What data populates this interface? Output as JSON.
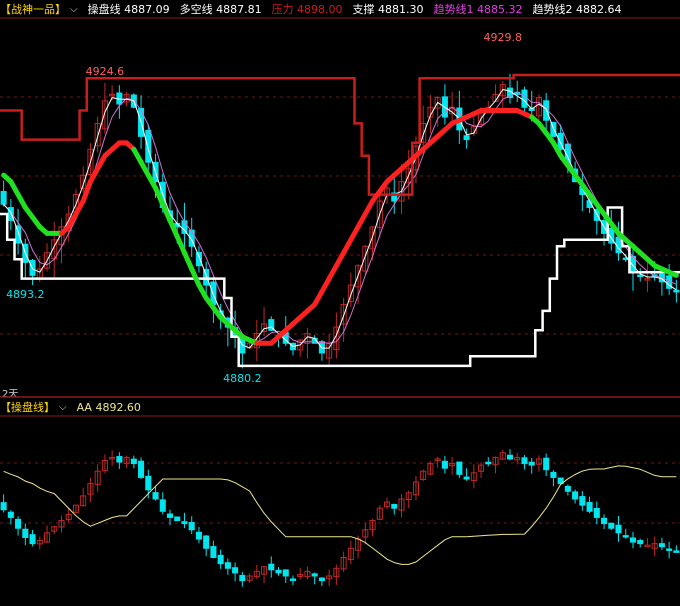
{
  "top_legend": {
    "indicator_name": "【战神一品】",
    "items": [
      {
        "label": "操盘线",
        "value": "4887.09",
        "color": "#ffffff"
      },
      {
        "label": "多空线",
        "value": "4887.81",
        "color": "#ffffff"
      },
      {
        "label": "压力",
        "value": "4898.00",
        "color": "#c81e1e"
      },
      {
        "label": "支撑",
        "value": "4881.30",
        "color": "#ffffff"
      },
      {
        "label": "趋势线1",
        "value": "4885.32",
        "color": "#e040e0"
      },
      {
        "label": "趋势线2",
        "value": "4882.64",
        "color": "#ffffff"
      }
    ]
  },
  "bottom_legend": {
    "indicator_name": "【操盘线】",
    "items": [
      {
        "label": "AA",
        "value": "4892.60",
        "color": "#f0e68c"
      }
    ]
  },
  "period_label": "2天",
  "colors": {
    "up": "#c02828",
    "down": "#00e5ee",
    "resistance": "#c81e1e",
    "support": "#ffffff",
    "trend_up": "#ff2020",
    "trend_down": "#20e020",
    "ma_fast": "#ffffff",
    "ma_slow": "#d070d0",
    "aa_line": "#f0e68c",
    "grid": "#6a1a1a",
    "border": "#8b1a1a"
  },
  "chart_data": [
    {
      "type": "candlestick",
      "y_range": [
        4876,
        4934
      ],
      "annotations": [
        {
          "text": "4924.6",
          "value": 4924.6,
          "index": 14,
          "color": "#ff6060"
        },
        {
          "text": "4929.8",
          "value": 4929.8,
          "index": 69,
          "color": "#ff6060"
        },
        {
          "text": "4893.2",
          "value": 4893.2,
          "index": 3,
          "color": "#00e5ee"
        },
        {
          "text": "4880.2",
          "value": 4880.2,
          "index": 33,
          "color": "#00e5ee"
        }
      ],
      "closes": [
        4905.5,
        4903,
        4899.5,
        4896.5,
        4894.5,
        4895.5,
        4898,
        4900,
        4902,
        4904,
        4907,
        4910,
        4914,
        4918,
        4921.5,
        4922.5,
        4921,
        4922.5,
        4920.5,
        4916,
        4912,
        4909,
        4905,
        4903,
        4902,
        4901,
        4899,
        4896,
        4893,
        4890,
        4888,
        4886.5,
        4885,
        4882.5,
        4884,
        4885.5,
        4887,
        4886,
        4885,
        4884,
        4883,
        4884.5,
        4885.5,
        4884,
        4882.5,
        4884,
        4886.5,
        4890,
        4893,
        4896,
        4899,
        4902,
        4906,
        4908,
        4906,
        4909,
        4911,
        4914.5,
        4918,
        4920.5,
        4922,
        4919,
        4920.5,
        4917,
        4915.5,
        4917.5,
        4920,
        4920.5,
        4922.5,
        4924,
        4922,
        4922.5,
        4920.5,
        4920,
        4922,
        4918.5,
        4916,
        4914,
        4911.5,
        4909,
        4907,
        4905,
        4903,
        4901,
        4899.5,
        4898,
        4897,
        4895,
        4894.5,
        4894,
        4894.5,
        4893.5,
        4892.5,
        4892
      ],
      "resistance": [
        4920,
        4920,
        4920,
        4915.5,
        4915.5,
        4915.5,
        4915.5,
        4915.5,
        4915.5,
        4915.5,
        4915.5,
        4920,
        4925,
        4925,
        4925,
        4925,
        4925,
        4925,
        4925,
        4925,
        4925,
        4925,
        4925,
        4925,
        4925,
        4925,
        4925,
        4925,
        4925,
        4925,
        4925,
        4925,
        4925,
        4925,
        4925,
        4925,
        4925,
        4925,
        4925,
        4925,
        4925,
        4925,
        4925,
        4925,
        4925,
        4925,
        4925,
        4925,
        4925,
        4918,
        4913,
        4907,
        4907,
        4907,
        4907,
        4907,
        4907,
        4915,
        4925,
        4925,
        4925,
        4925,
        4925,
        4925,
        4925,
        4925,
        4925,
        4925,
        4925,
        4925,
        4925,
        4925.5,
        4925.5,
        4925.5,
        4925.5,
        4925.5,
        4925.5,
        4925.5,
        4925.5,
        4925.5,
        4925.5,
        4925.5,
        4925.5,
        4925.5,
        4925.5,
        4925.5,
        4925.5,
        4925.5,
        4925.5,
        4925.5,
        4925.5,
        4925.5,
        4925.5,
        4925.5
      ],
      "support": [
        4904,
        4900,
        4897,
        4894,
        4894,
        4894,
        4894,
        4894,
        4894,
        4894,
        4894,
        4894,
        4894,
        4894,
        4894,
        4894,
        4894,
        4894,
        4894,
        4894,
        4894,
        4894,
        4894,
        4894,
        4894,
        4894,
        4894,
        4894,
        4894,
        4894,
        4894,
        4891,
        4885,
        4880.5,
        4880.5,
        4880.5,
        4880.5,
        4880.5,
        4880.5,
        4880.5,
        4880.5,
        4880.5,
        4880.5,
        4880.5,
        4880.5,
        4880.5,
        4880.5,
        4880.5,
        4880.5,
        4880.5,
        4880.5,
        4880.5,
        4880.5,
        4880.5,
        4880.5,
        4880.5,
        4880.5,
        4880.5,
        4880.5,
        4880.5,
        4880.5,
        4880.5,
        4880.5,
        4880.5,
        4880.5,
        4882,
        4882,
        4882,
        4882,
        4882,
        4882,
        4882,
        4882,
        4882,
        4886,
        4889,
        4894,
        4899,
        4900,
        4900,
        4900,
        4900,
        4900,
        4900,
        4905,
        4905,
        4899,
        4895,
        4895,
        4895,
        4895,
        4895,
        4895,
        4895
      ],
      "trend": [
        4910,
        4909,
        4907,
        4905,
        4903.5,
        4902,
        4901,
        4901,
        4901,
        4902,
        4904,
        4906,
        4909,
        4911,
        4913,
        4914,
        4915,
        4915,
        4914,
        4912,
        4910,
        4908,
        4905.5,
        4903,
        4900.5,
        4898,
        4895.5,
        4893,
        4891,
        4889.5,
        4888,
        4887,
        4886,
        4885,
        4884.5,
        4884,
        4884,
        4884,
        4885,
        4886,
        4887,
        4888,
        4889,
        4890,
        4892,
        4894,
        4896,
        4898,
        4900,
        4902,
        4904,
        4906,
        4907.5,
        4909,
        4910,
        4911,
        4912,
        4913,
        4914,
        4915,
        4916,
        4917,
        4918,
        4918.5,
        4919,
        4919.5,
        4920,
        4920,
        4920,
        4920,
        4920,
        4920,
        4919.5,
        4919,
        4918,
        4916.5,
        4915,
        4913,
        4911.5,
        4910,
        4908.5,
        4907,
        4905.5,
        4904,
        4902.5,
        4901,
        4900,
        4899,
        4898,
        4897,
        4896,
        4895.5,
        4895,
        4894.5
      ],
      "trend_up_flags": [
        0,
        0,
        0,
        0,
        0,
        0,
        0,
        0,
        1,
        1,
        1,
        1,
        1,
        1,
        1,
        1,
        1,
        1,
        0,
        0,
        0,
        0,
        0,
        0,
        0,
        0,
        0,
        0,
        0,
        0,
        0,
        0,
        0,
        0,
        0,
        1,
        1,
        1,
        1,
        1,
        1,
        1,
        1,
        1,
        1,
        1,
        1,
        1,
        1,
        1,
        1,
        1,
        1,
        1,
        1,
        1,
        1,
        1,
        1,
        1,
        1,
        1,
        1,
        1,
        1,
        1,
        1,
        1,
        1,
        1,
        1,
        1,
        1,
        0,
        0,
        0,
        0,
        0,
        0,
        0,
        0,
        0,
        0,
        0,
        0,
        0,
        0,
        0,
        0,
        0,
        0,
        0,
        0,
        0
      ]
    },
    {
      "type": "candlestick",
      "y_range": [
        4876,
        4934
      ],
      "series": [
        {
          "name": "AA",
          "current": 4892.6
        }
      ]
    }
  ]
}
